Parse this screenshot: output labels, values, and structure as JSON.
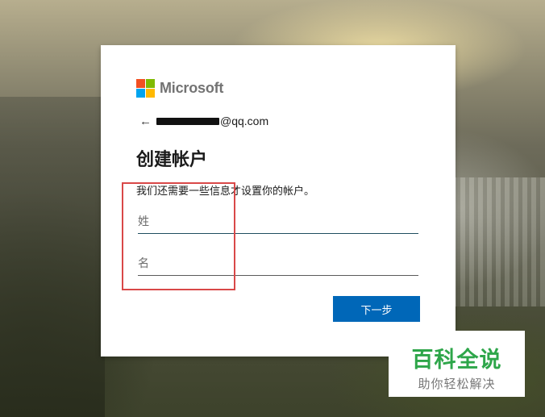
{
  "brand": {
    "name": "Microsoft",
    "logo_colors": [
      "#f25022",
      "#7fba00",
      "#00a4ef",
      "#ffb900"
    ]
  },
  "identity": {
    "email_suffix": "@qq.com"
  },
  "form": {
    "title": "创建帐户",
    "description": "我们还需要一些信息才设置你的帐户。",
    "last_name_placeholder": "姓",
    "first_name_placeholder": "名",
    "next_label": "下一步"
  },
  "watermark": {
    "title": "百科全说",
    "subtitle": "助你轻松解决"
  },
  "colors": {
    "primary_button": "#0067b8",
    "highlight_box": "#d94848",
    "watermark_green": "#2ea64a"
  }
}
